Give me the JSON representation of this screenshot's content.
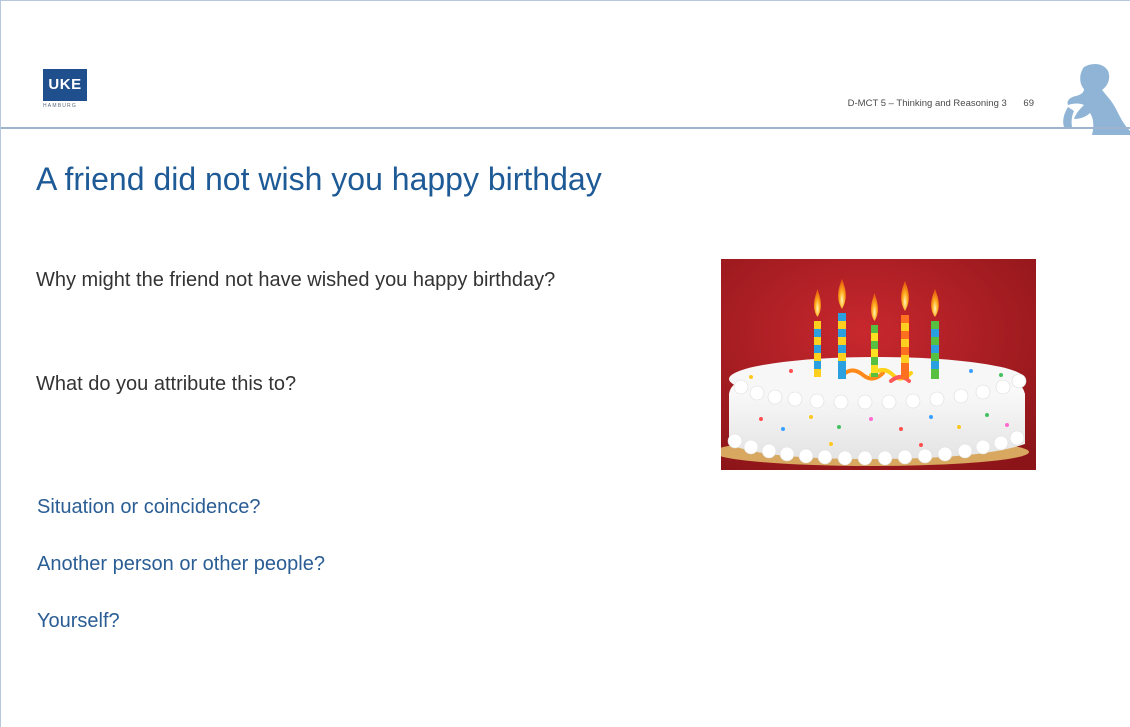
{
  "header": {
    "logo_text": "UKE",
    "logo_subtext": "HAMBURG",
    "course": "D-MCT 5 – Thinking and Reasoning 3",
    "page_number": "69"
  },
  "slide": {
    "title": "A friend did not wish you happy birthday",
    "questions": [
      "Why might the friend not have wished you happy birthday?",
      "What do you attribute this to?"
    ],
    "options": [
      "Situation or coincidence?",
      "Another person or other people?",
      "Yourself?"
    ]
  },
  "colors": {
    "title": "#1d5a96",
    "options": "#2a5d94",
    "body_text": "#333333",
    "logo": "#1f4f8c",
    "thinker": "#8fb4d6",
    "rule": "#9db4cf"
  },
  "icons": {
    "logo": "uke-logo-icon",
    "thinker": "thinker-figure-icon",
    "image": "birthday-cake-photo"
  }
}
